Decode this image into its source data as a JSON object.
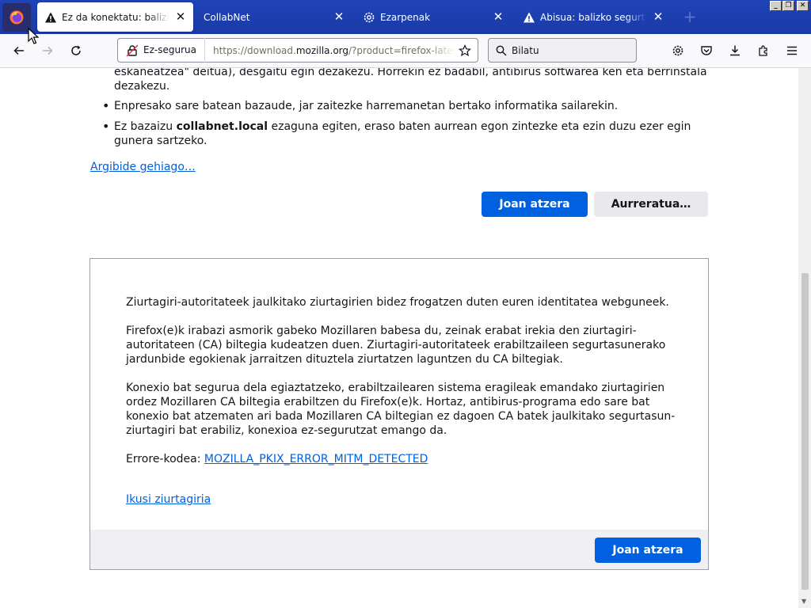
{
  "tabs": [
    {
      "title": "Ez da konektatu: balizko segurtasun",
      "close": "✕",
      "icon": "warning-icon",
      "active": true
    },
    {
      "title": "CollabNet",
      "close": "✕",
      "icon": "",
      "active": false
    },
    {
      "title": "Ezarpenak",
      "close": "✕",
      "icon": "gear-icon",
      "active": false
    },
    {
      "title": "Abisua: balizko segurtasun arazoa",
      "close": "✕",
      "icon": "warning-icon",
      "active": false
    }
  ],
  "new_tab_label": "+",
  "window_controls": {
    "minimize": "_",
    "restore": "❐",
    "close": "✕"
  },
  "urlbar": {
    "identity_label": "Ez-segurua",
    "url_prefix": "https://download.",
    "url_domain": "mozilla.org",
    "url_suffix": "/?product=firefox-latest-ssl&os=win"
  },
  "searchbar": {
    "placeholder": "Bilatu"
  },
  "content": {
    "intro_line1": "eskaneatzea\" deitua), desgaitu egin dezakezu. Horrekin ez badabil, antibirus softwarea ken eta berrinstala",
    "intro_line2": "dezakezu.",
    "bullet1": "Enpresako sare batean bazaude, jar zaitezke harremanetan bertako informatika sailarekin.",
    "bullet2_pre": "Ez bazaizu ",
    "bullet2_bold": "collabnet.local",
    "bullet2_post": " ezaguna egiten, eraso baten aurrean egon zintezke eta ezin duzu ezer egin gunera sartzeko.",
    "learn_more": "Argibide gehiago…",
    "go_back": "Joan atzera",
    "advanced": "Aurreratua…"
  },
  "advanced_panel": {
    "p1": "Ziurtagiri-autoritateek jaulkitako ziurtagirien bidez frogatzen duten euren identitatea webguneek.",
    "p2": "Firefox(e)k irabazi asmorik gabeko Mozillaren babesa du, zeinak erabat irekia den ziurtagiri-autoritateen (CA) biltegia kudeatzen duen. Ziurtagiri-autoritateek erabiltzaileen segurtasunerako jardunbide egokienak jarraitzen dituztela ziurtatzen laguntzen du CA biltegiak.",
    "p3": "Konexio bat segurua dela egiaztatzeko, erabiltzailearen sistema eragileak emandako ziurtagirien ordez Mozillaren CA biltegia erabiltzen du Firefox(e)k. Hortaz, antibirus-programa edo sare bat konexio bat atzematen ari bada Mozillaren CA biltegian ez dagoen CA batek jaulkitako segurtasun-ziurtagiri bat erabiliz, konexioa ez-segurutzat emango da.",
    "error_label": "Errore-kodea: ",
    "error_code": "MOZILLA_PKIX_ERROR_MITM_DETECTED",
    "view_cert": "Ikusi ziurtagiria",
    "go_back": "Joan atzera"
  },
  "colors": {
    "tabbar": "#1f43b8",
    "primary_button": "#0061e0",
    "link": "#0060df"
  }
}
